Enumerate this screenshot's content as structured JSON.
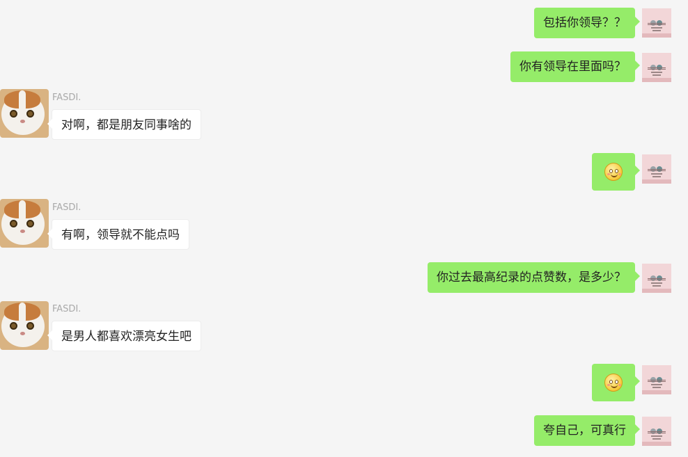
{
  "contact": {
    "name": "FASDI."
  },
  "messages": [
    {
      "side": "out",
      "type": "text",
      "text": "包括你领导？？"
    },
    {
      "side": "out",
      "type": "text",
      "text": "你有领导在里面吗？"
    },
    {
      "side": "in",
      "type": "text",
      "sender": "FASDI.",
      "text": "对啊，都是朋友同事啥的"
    },
    {
      "side": "out",
      "type": "emoji",
      "icon": "smiley-emoji-icon"
    },
    {
      "side": "in",
      "type": "text",
      "sender": "FASDI.",
      "text": "有啊，领导就不能点吗"
    },
    {
      "side": "out",
      "type": "text",
      "text": "你过去最高纪录的点赞数，是多少？"
    },
    {
      "side": "in",
      "type": "text",
      "sender": "FASDI.",
      "text": "是男人都喜欢漂亮女生吧"
    },
    {
      "side": "out",
      "type": "emoji",
      "icon": "smiley-emoji-icon"
    },
    {
      "side": "out",
      "type": "text",
      "text": "夸自己，可真行"
    }
  ],
  "colors": {
    "background": "#f5f5f5",
    "outgoing_bubble": "#95ec69",
    "incoming_bubble": "#ffffff",
    "sender_name": "#a9a9a9"
  }
}
